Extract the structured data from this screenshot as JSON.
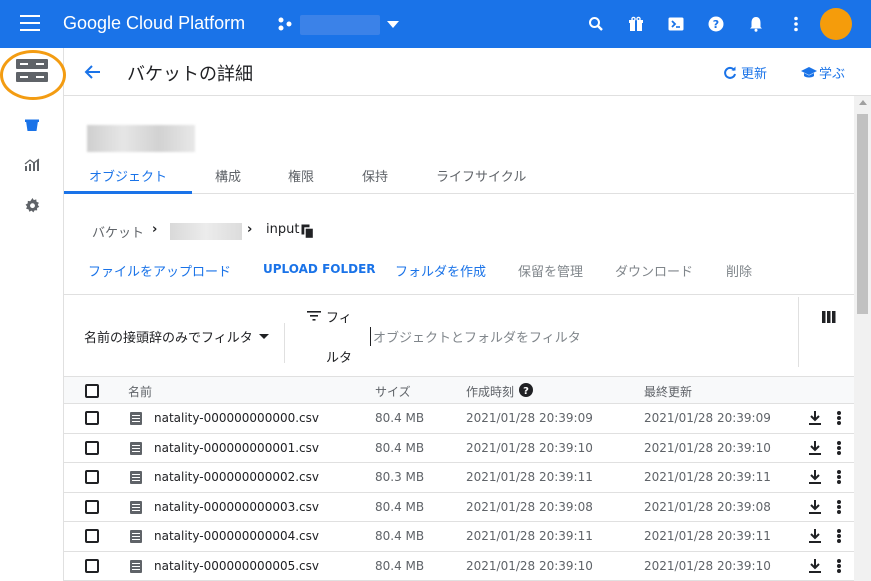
{
  "topbar": {
    "brand": "Google Cloud Platform",
    "icons": [
      "menu-icon",
      "project-icon",
      "search-icon",
      "gift-icon",
      "cloud-shell-icon",
      "help-icon",
      "notifications-icon",
      "more-vert-icon",
      "account-avatar"
    ]
  },
  "header": {
    "title": "バケットの詳細",
    "refresh_label": "更新",
    "learn_label": "学ぶ"
  },
  "tabs": [
    "オブジェクト",
    "構成",
    "権限",
    "保持",
    "ライフサイクル"
  ],
  "breadcrumb": {
    "root": "バケット",
    "folder": "input"
  },
  "actions": {
    "upload_files": "ファイルをアップロード",
    "upload_folder": "UPLOAD FOLDER",
    "create_folder": "フォルダを作成",
    "manage_holds": "保留を管理",
    "download": "ダウンロード",
    "delete": "削除"
  },
  "filter": {
    "prefix_filter": "名前の接頭辞のみでフィルタ",
    "filter_label_1": "フィ",
    "filter_label_2": "ルタ",
    "placeholder": "オブジェクトとフォルダをフィルタ"
  },
  "table": {
    "headers": {
      "name": "名前",
      "size": "サイズ",
      "created": "作成時刻",
      "updated": "最終更新"
    },
    "rows": [
      {
        "name": "natality-000000000000.csv",
        "size": "80.4 MB",
        "created": "2021/01/28 20:39:09",
        "updated": "2021/01/28 20:39:09"
      },
      {
        "name": "natality-000000000001.csv",
        "size": "80.4 MB",
        "created": "2021/01/28 20:39:10",
        "updated": "2021/01/28 20:39:10"
      },
      {
        "name": "natality-000000000002.csv",
        "size": "80.3 MB",
        "created": "2021/01/28 20:39:11",
        "updated": "2021/01/28 20:39:11"
      },
      {
        "name": "natality-000000000003.csv",
        "size": "80.4 MB",
        "created": "2021/01/28 20:39:08",
        "updated": "2021/01/28 20:39:08"
      },
      {
        "name": "natality-000000000004.csv",
        "size": "80.4 MB",
        "created": "2021/01/28 20:39:11",
        "updated": "2021/01/28 20:39:11"
      },
      {
        "name": "natality-000000000005.csv",
        "size": "80.4 MB",
        "created": "2021/01/28 20:39:10",
        "updated": "2021/01/28 20:39:10"
      }
    ]
  },
  "colors": {
    "topbar": "#1a73e8",
    "accent": "#1a73e8",
    "avatar": "#f59c0b",
    "highlight_ring": "#f39c12"
  }
}
